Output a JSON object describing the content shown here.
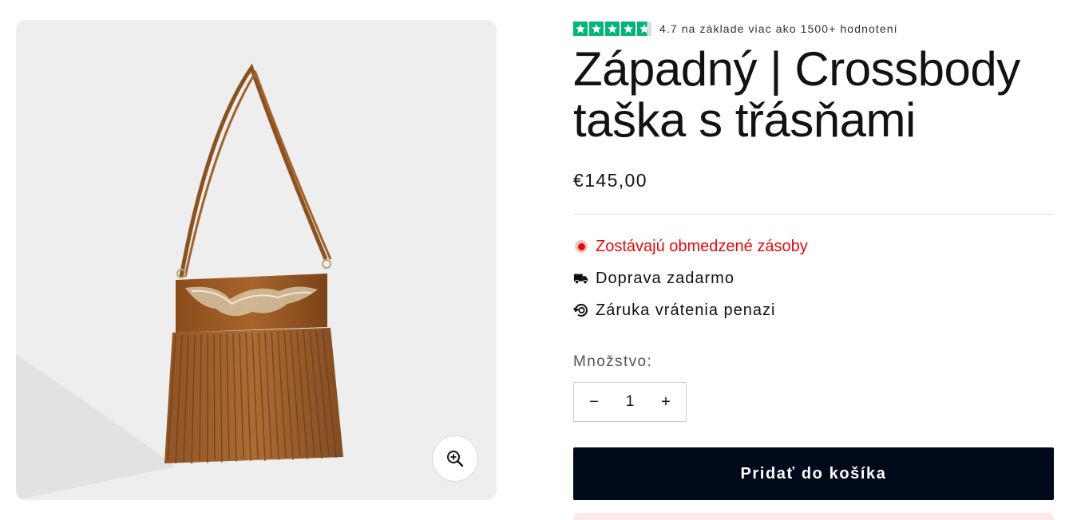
{
  "rating": {
    "value_text": "4.7 na základe viac ako 1500+ hodnotení",
    "stars_filled": 4.7,
    "stars_total": 5,
    "star_color": "#00b67a"
  },
  "product": {
    "title": "Západný | Crossbody taška s třásňami",
    "price": "€145,00"
  },
  "features": {
    "stock": "Zostávajú obmedzené zásoby",
    "shipping": "Doprava zadarmo",
    "returns": "Záruka vrátenia penazi"
  },
  "quantity": {
    "label": "Množstvo:",
    "value": "1",
    "minus": "−",
    "plus": "+"
  },
  "cart": {
    "label": "Pridať do košíka"
  },
  "colors": {
    "stock_red": "#e30b0b",
    "button_bg": "#000a1a",
    "media_bg": "#eeeeee"
  },
  "icons": {
    "zoom": "zoom-in-icon",
    "truck": "truck-icon",
    "returns": "money-back-icon",
    "stock": "stock-dot-icon"
  }
}
